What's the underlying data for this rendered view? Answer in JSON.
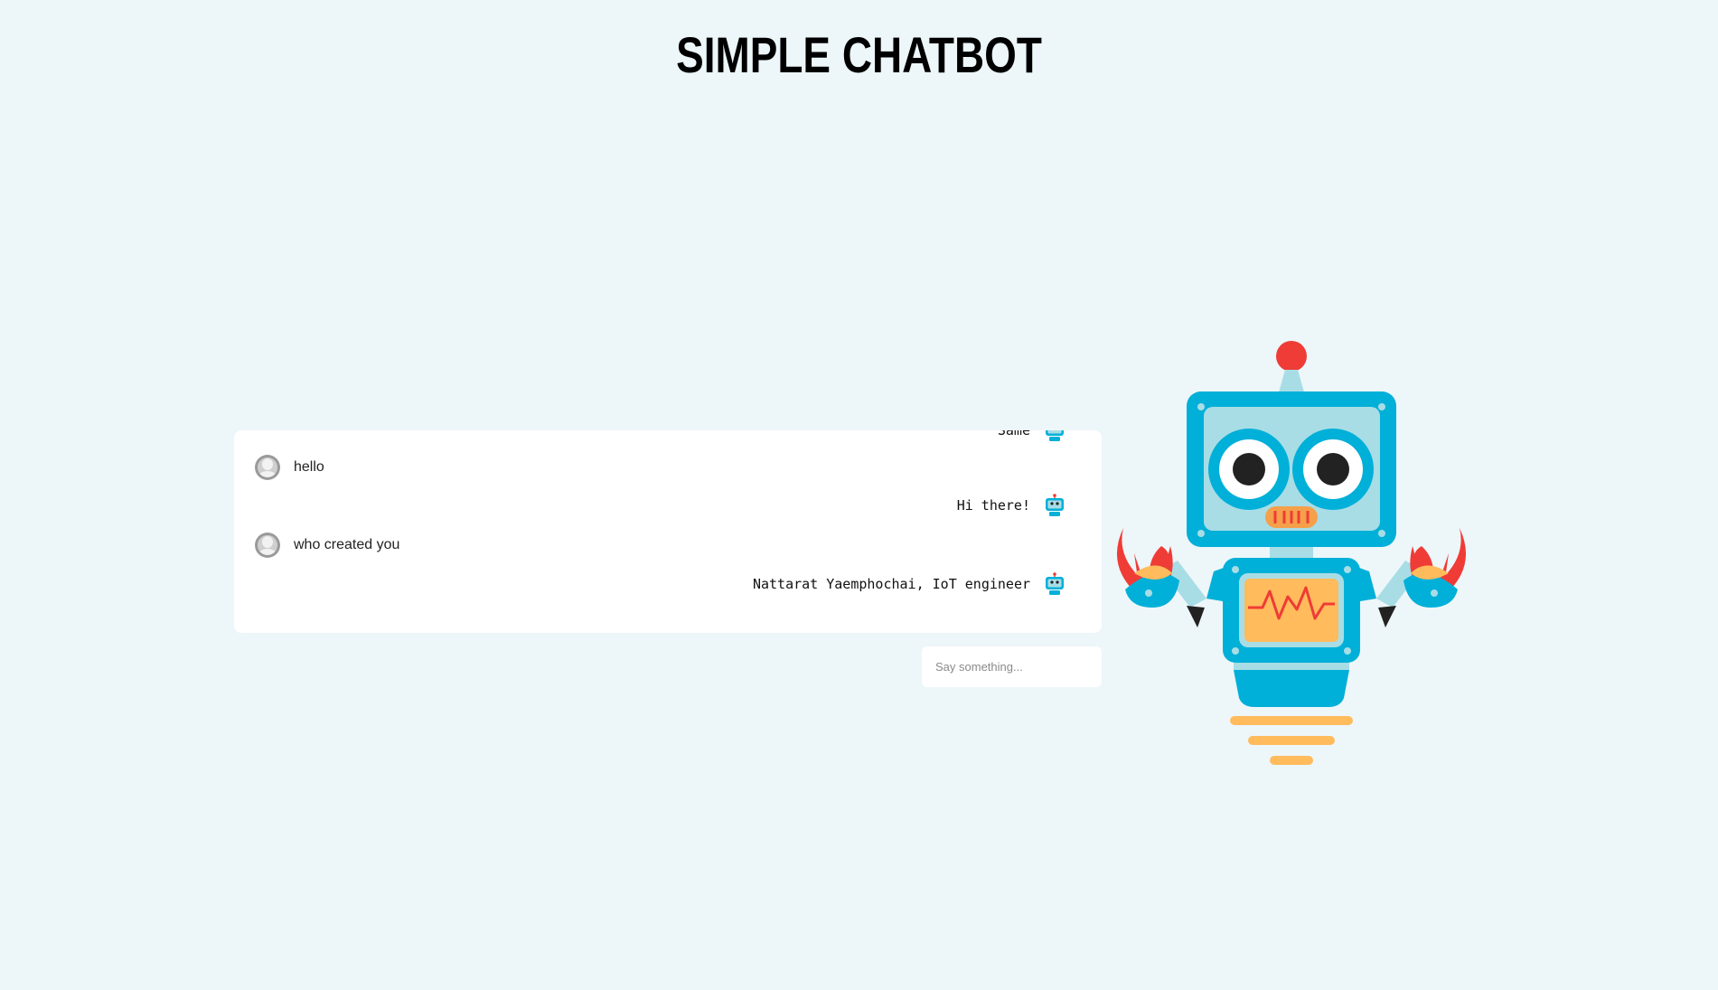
{
  "page": {
    "title": "SIMPLE CHATBOT"
  },
  "chat": {
    "messages": [
      {
        "sender": "bot",
        "text": "Same"
      },
      {
        "sender": "user",
        "text": "hello"
      },
      {
        "sender": "bot",
        "text": "Hi there!"
      },
      {
        "sender": "user",
        "text": "who created you"
      },
      {
        "sender": "bot",
        "text": "Nattarat Yaemphochai, IoT engineer"
      }
    ]
  },
  "input": {
    "placeholder": "Say something...",
    "value": ""
  },
  "icons": {
    "user_avatar": "user-avatar-icon",
    "bot_avatar": "robot-icon",
    "illustration": "robot-illustration"
  },
  "colors": {
    "background": "#edf6f9",
    "robot_blue": "#00b0d8",
    "robot_red": "#ef3c36",
    "robot_orange": "#ffbb5c"
  }
}
